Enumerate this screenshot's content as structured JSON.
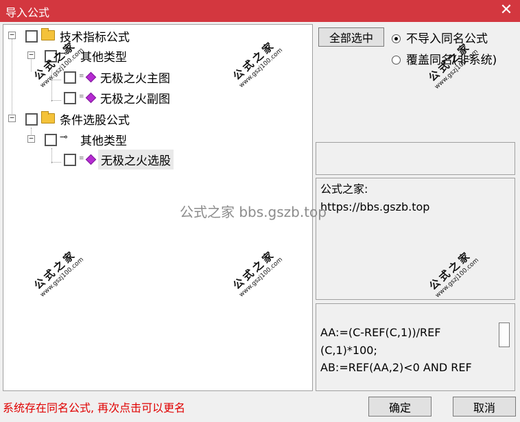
{
  "window": {
    "title": "导入公式",
    "close_glyph": "✕"
  },
  "tree": {
    "items": [
      {
        "label": "技术指标公式",
        "icon": "folder-icon"
      },
      {
        "label": "其他类型",
        "icon": "key-icon"
      },
      {
        "label": "无极之火主图",
        "icon": "gem-icon"
      },
      {
        "label": "无极之火副图",
        "icon": "gem-icon"
      },
      {
        "label": "条件选股公式",
        "icon": "folder-icon"
      },
      {
        "label": "其他类型",
        "icon": "key-icon"
      },
      {
        "label": "无极之火选股",
        "icon": "gem-icon"
      }
    ],
    "expander_glyph": "−",
    "key_glyph": "⊸"
  },
  "watermark": {
    "cn": "公式之家",
    "url": "www.gszj100.com"
  },
  "center_watermark": "公式之家 bbs.gszb.top",
  "toolbar": {
    "select_all_label": "全部选中"
  },
  "import_options": {
    "skip_same_name_label": "不导入同名公式",
    "overwrite_label": "覆盖同名(非系统)",
    "selected": "skip_same_name"
  },
  "description": {
    "line1": "公式之家:",
    "line2": "https://bbs.gszb.top"
  },
  "code": {
    "line1": "AA:=(C-REF(C,1))/REF",
    "line2": "(C,1)*100;",
    "line3": "AB:=REF(AA,2)<0 AND REF"
  },
  "status_message": "系统存在同名公式, 再次点击可以更名",
  "buttons": {
    "ok_label": "确定",
    "cancel_label": "取消"
  }
}
